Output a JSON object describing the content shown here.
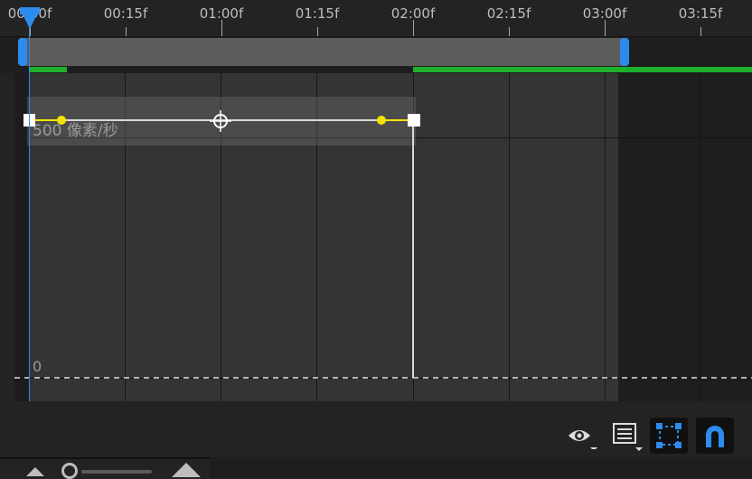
{
  "ruler": {
    "labels": [
      "00:00f",
      "00:15f",
      "01:00f",
      "01:15f",
      "02:00f",
      "02:15f",
      "03:00f",
      "03:15f"
    ]
  },
  "graph": {
    "value_label": "500 像素/秒",
    "zero_label": "0"
  },
  "colors": {
    "accent": "#2d8ceb",
    "work_area": "#1cb12c",
    "keyframe_handle": "#f5e400",
    "curve": "#d8d8d8"
  },
  "toolbar": {
    "show_icon": "eye-icon",
    "graph_options_icon": "list-icon",
    "transform_box_icon": "transform-box-icon",
    "snap_icon": "magnet-icon"
  },
  "zoom": {
    "left_icon": "zoom-out-icon",
    "right_icon": "zoom-in-icon"
  }
}
